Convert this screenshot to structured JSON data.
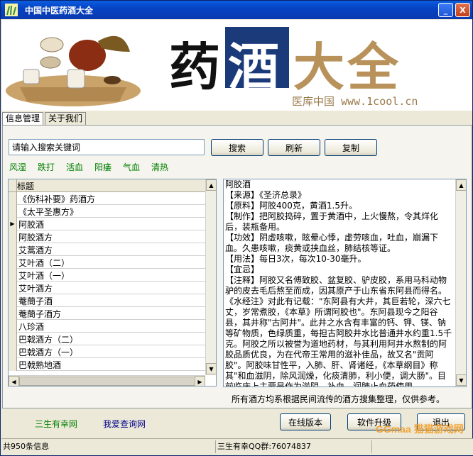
{
  "window": {
    "title": "中国中医药酒大全",
    "min_label": "_",
    "close_label": "X"
  },
  "banner": {
    "char1": "药",
    "char2": "酒",
    "char3": "大全",
    "subtitle": "医库中国 www.1cool.cn"
  },
  "tabs": [
    {
      "label": "信息管理"
    },
    {
      "label": "关于我们"
    }
  ],
  "search": {
    "value": "请输入搜索关键词"
  },
  "buttons": {
    "search": "搜索",
    "refresh": "刷新",
    "copy": "复制",
    "online": "在线版本",
    "upgrade": "软件升级",
    "exit": "退出"
  },
  "categories": [
    "风湿",
    "跌打",
    "活血",
    "阳痿",
    "气血",
    "清热"
  ],
  "grid": {
    "header": "标题",
    "rows": [
      "《伤科补要》药酒方",
      "《太平圣惠方》",
      "阿胶酒",
      "阿胶酒方",
      "艾蒿酒方",
      "艾叶酒（二）",
      "艾叶酒（一）",
      "艾叶酒方",
      "菴蕳子酒",
      "菴蕳子酒方",
      "八珍酒",
      "巴戟酒方（二）",
      "巴戟酒方（一）",
      "巴戟熟地酒"
    ],
    "selected_index": 2
  },
  "detail": {
    "text": "阿胶酒\n【来源】《圣济总录》\n【原料】阿胶400克，黄酒1.5升。\n【制作】把阿胶捣碎，置于黄酒中，上火慢熬，令其烊化后，装瓶备用。\n【功效】阴虚咳嗽，眩晕心悸，虚劳咳血，吐血，崩漏下血。久患咳嗽，痰黄或挟血丝，肺结核等证。\n【用法】每日3次，每次10-30毫升。\n【宜忌】\n【注释】阿胶又名傅致胶、盆复胶、驴皮胶，系用马科动物驴的皮去毛后熬至而成，因其原产于山东省东阿县而得名。《水经注》对此有记载：\"东阿县有大井，其巨若轮，深六七丈，岁常煮胶，《本草》所谓阿胶也\"。东阿县现今之阳谷县，其井称\"古阿井\"。此井之水含有丰富的钙、钾、镁、钠等矿物质，色绿质重，每担古阿胶井水比普通井水约重1.5千克。阿胶之所以被誉为道地药材，与其利用阿井水熬制的阿胶品质优良，为在代帝王常用的滋补佳品，故又名\"贡阿胶\"。阿胶味甘性平，入肺、肝、肾诸经，《本草纲目》称其\"和血滋阴，除风润燥，化痰清肺，利小便，调大肠\"。目前临床上主要是作为滋阴、补血、润肺止血药使用。"
  },
  "note": "所有酒方均系根据民间流传的酒方搜集整理，仅供参考。",
  "footer": {
    "link1": "三生有幸网",
    "link2": "我爱查询网"
  },
  "status": {
    "count": "共950条信息",
    "qq": "三生有幸QQ群:76074837"
  },
  "watermark": "GGmaa 猫猫游戏网"
}
